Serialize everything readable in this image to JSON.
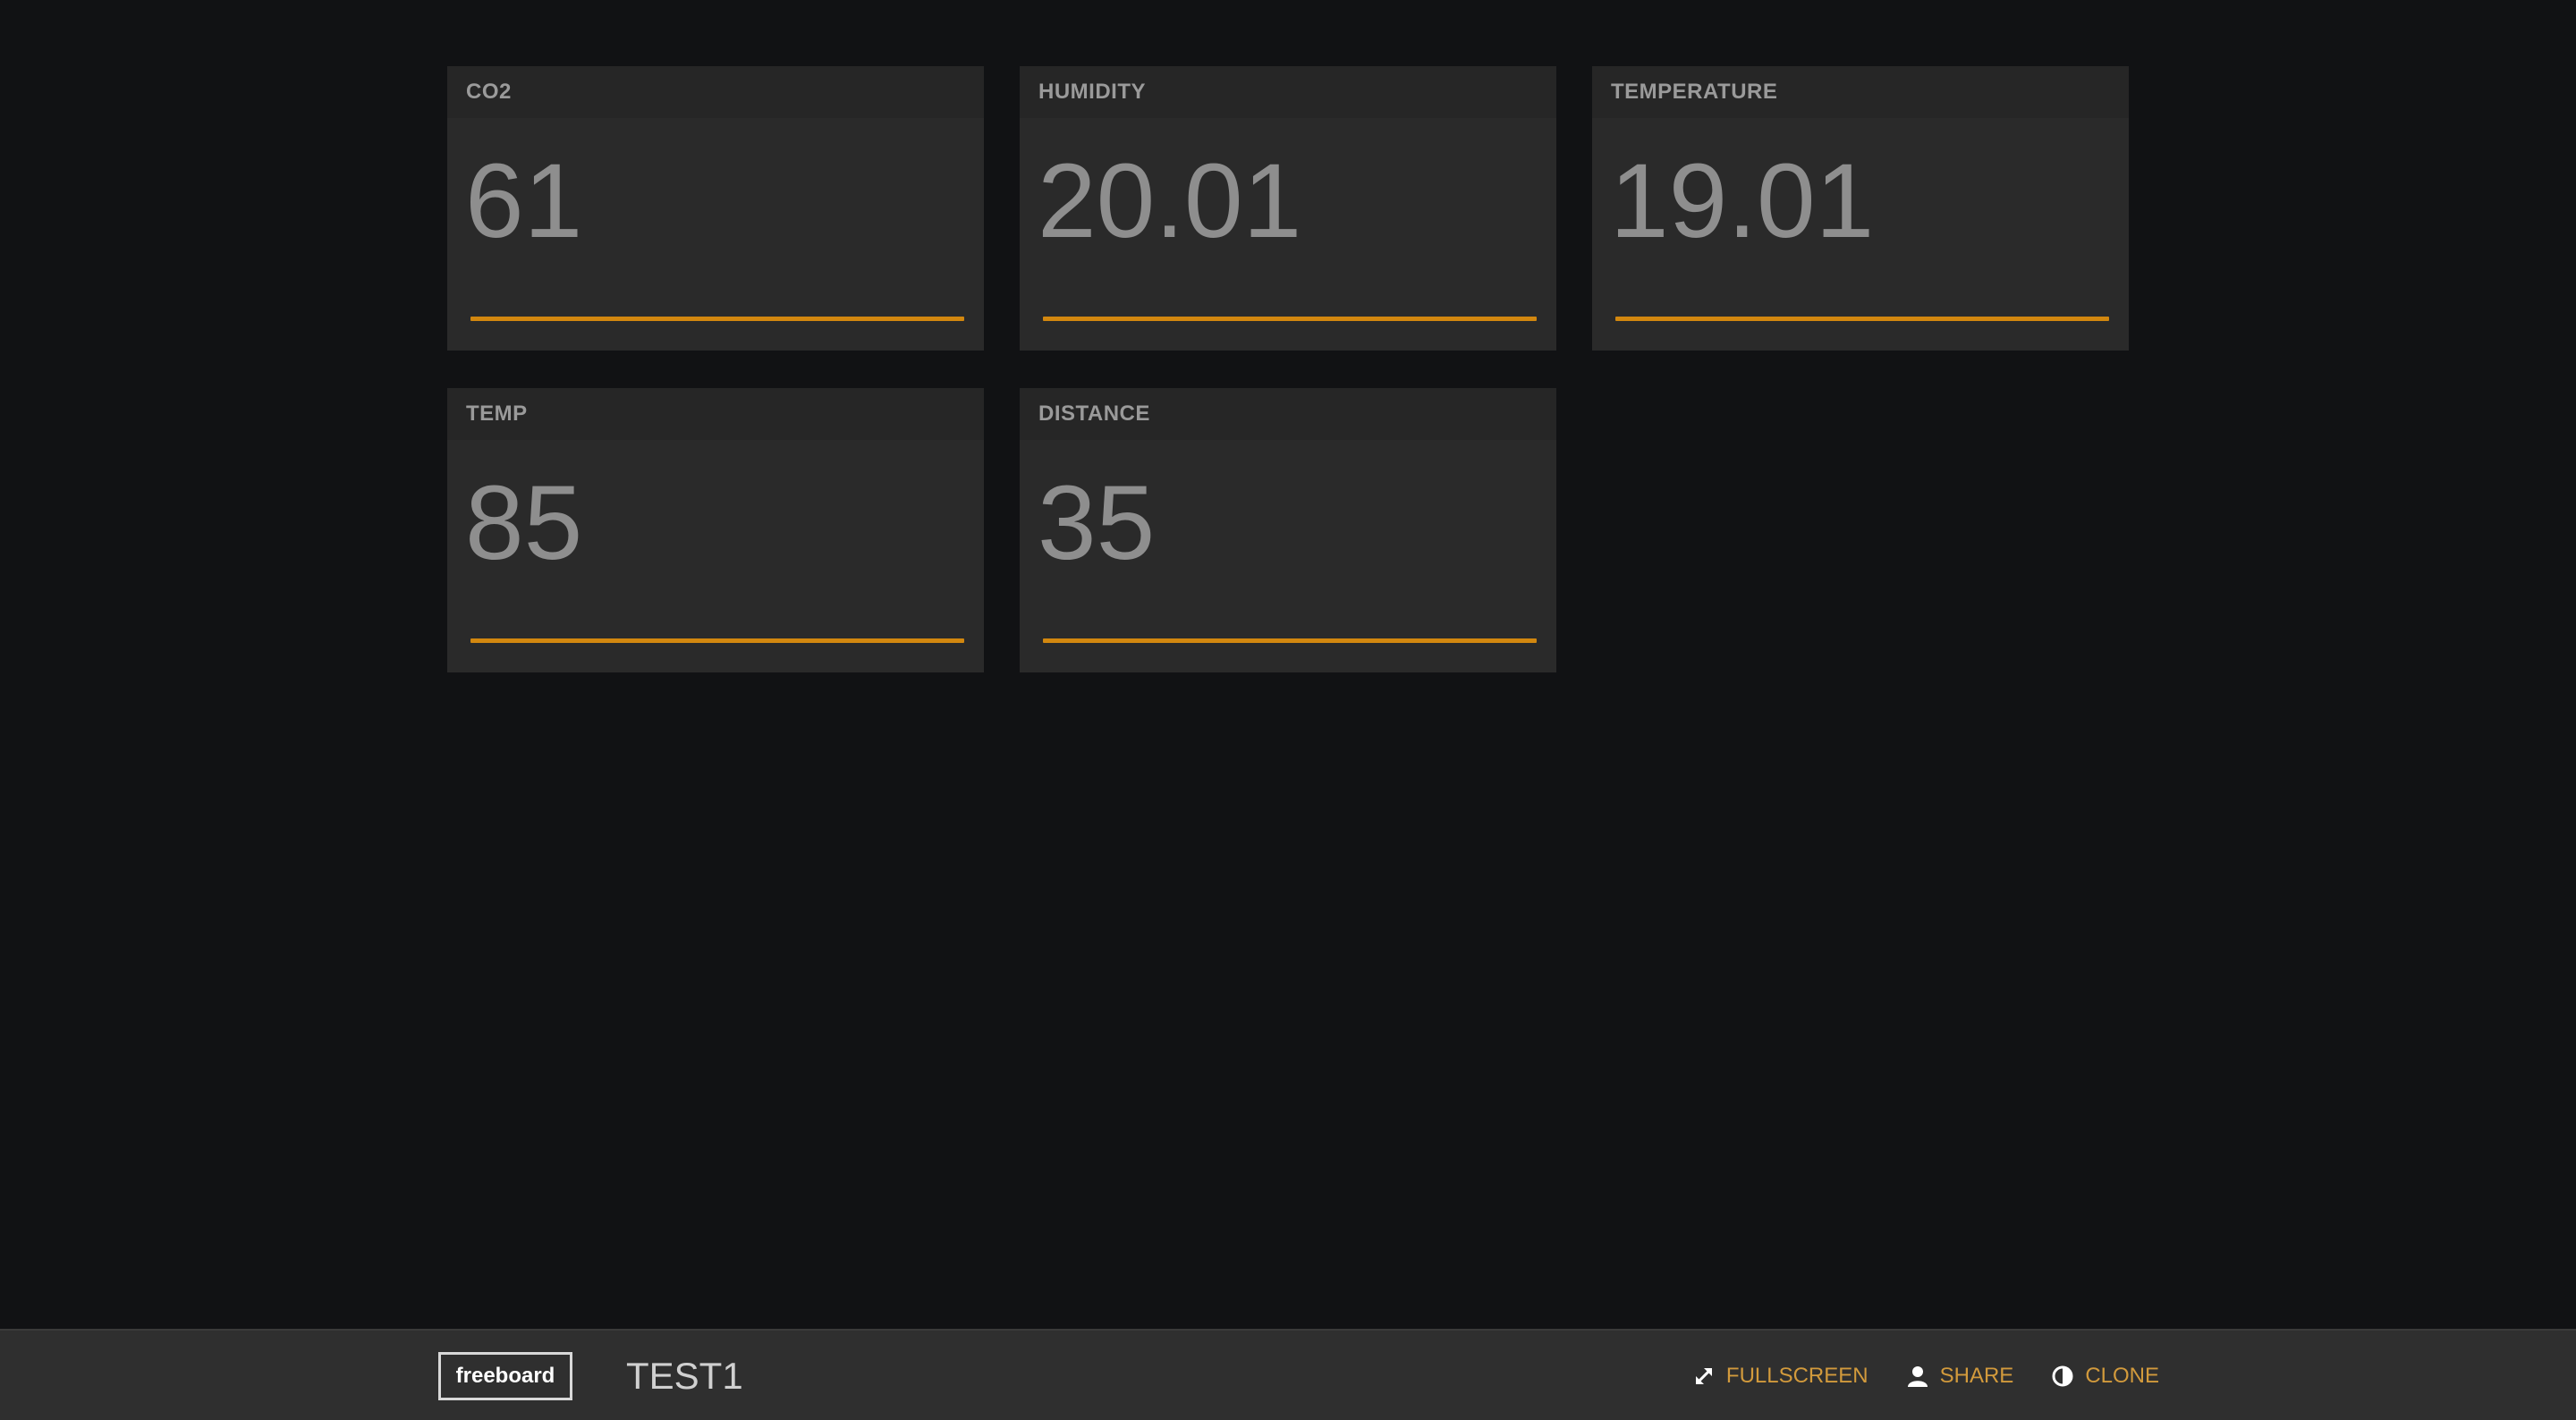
{
  "panes": [
    {
      "title": "CO2",
      "value": "61"
    },
    {
      "title": "HUMIDITY",
      "value": "20.01"
    },
    {
      "title": "TEMPERATURE",
      "value": "19.01"
    },
    {
      "title": "TEMP",
      "value": "85"
    },
    {
      "title": "DISTANCE",
      "value": "35"
    }
  ],
  "footer": {
    "logo": "freeboard",
    "board_name": "TEST1",
    "actions": {
      "fullscreen": "FULLSCREEN",
      "share": "SHARE",
      "clone": "CLONE"
    }
  },
  "colors": {
    "accent": "#d2870f",
    "action_text": "#d29a3c",
    "background": "#111214",
    "pane": "#2a2a2a",
    "footer": "#2f2f2f"
  },
  "icons": {
    "fullscreen": "expand-arrows-icon",
    "share": "user-icon",
    "clone": "half-circle-icon"
  }
}
